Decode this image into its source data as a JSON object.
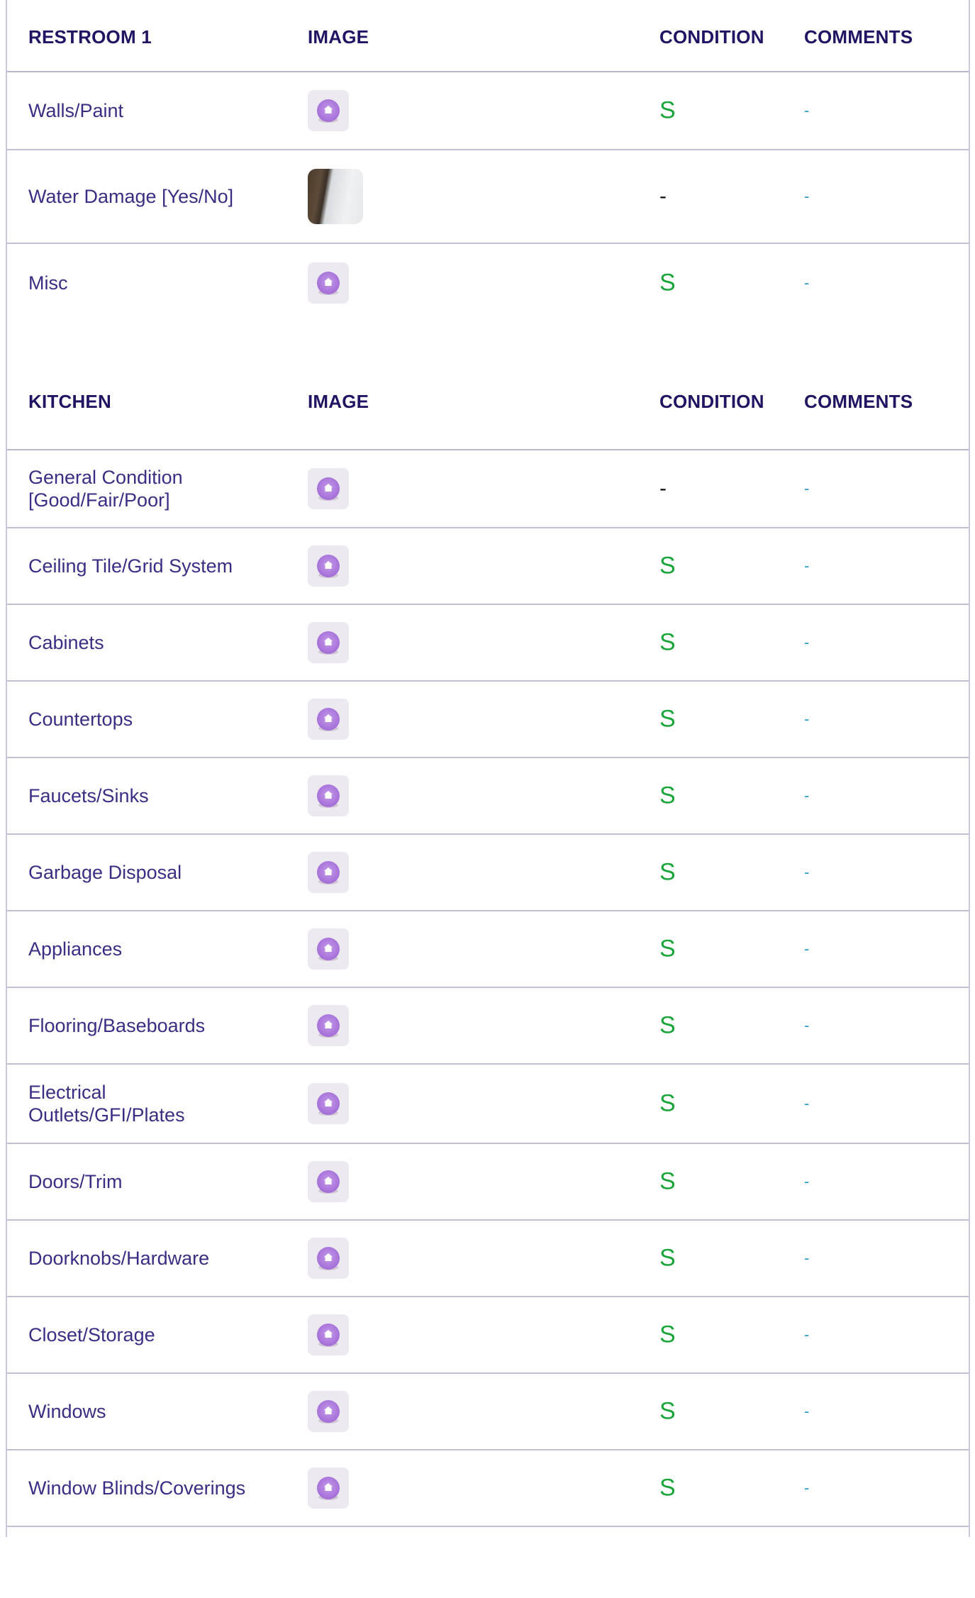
{
  "sections": [
    {
      "title": "RESTROOM 1",
      "col_image": "IMAGE",
      "col_condition": "CONDITION",
      "col_comments": "COMMENTS",
      "rows": [
        {
          "item": "Walls/Paint",
          "image": "placeholder-house-icon",
          "condition": "S",
          "comment": "-"
        },
        {
          "item": "Water Damage [Yes/No]",
          "image": "photo",
          "condition": "-",
          "comment": "-"
        },
        {
          "item": "Misc",
          "image": "placeholder-house-icon",
          "condition": "S",
          "comment": "-"
        }
      ]
    },
    {
      "title": "KITCHEN",
      "col_image": "IMAGE",
      "col_condition": "CONDITION",
      "col_comments": "COMMENTS",
      "rows": [
        {
          "item": "General Condition [Good/Fair/Poor]",
          "image": "placeholder-house-icon",
          "condition": "-",
          "comment": "-"
        },
        {
          "item": "Ceiling Tile/Grid System",
          "image": "placeholder-house-icon",
          "condition": "S",
          "comment": "-"
        },
        {
          "item": "Cabinets",
          "image": "placeholder-house-icon",
          "condition": "S",
          "comment": "-"
        },
        {
          "item": "Countertops",
          "image": "placeholder-house-icon",
          "condition": "S",
          "comment": "-"
        },
        {
          "item": "Faucets/Sinks",
          "image": "placeholder-house-icon",
          "condition": "S",
          "comment": "-"
        },
        {
          "item": "Garbage Disposal",
          "image": "placeholder-house-icon",
          "condition": "S",
          "comment": "-"
        },
        {
          "item": "Appliances",
          "image": "placeholder-house-icon",
          "condition": "S",
          "comment": "-"
        },
        {
          "item": "Flooring/Baseboards",
          "image": "placeholder-house-icon",
          "condition": "S",
          "comment": "-"
        },
        {
          "item": "Electrical Outlets/GFI/Plates",
          "image": "placeholder-house-icon",
          "condition": "S",
          "comment": "-"
        },
        {
          "item": "Doors/Trim",
          "image": "placeholder-house-icon",
          "condition": "S",
          "comment": "-"
        },
        {
          "item": "Doorknobs/Hardware",
          "image": "placeholder-house-icon",
          "condition": "S",
          "comment": "-"
        },
        {
          "item": "Closet/Storage",
          "image": "placeholder-house-icon",
          "condition": "S",
          "comment": "-"
        },
        {
          "item": "Windows",
          "image": "placeholder-house-icon",
          "condition": "S",
          "comment": "-"
        },
        {
          "item": "Window Blinds/Coverings",
          "image": "placeholder-house-icon",
          "condition": "S",
          "comment": "-"
        }
      ]
    }
  ],
  "colors": {
    "header_text": "#1f1563",
    "item_text": "#3c2d84",
    "condition_ok": "#1aa53a",
    "comment_text": "#2b9bc6"
  }
}
